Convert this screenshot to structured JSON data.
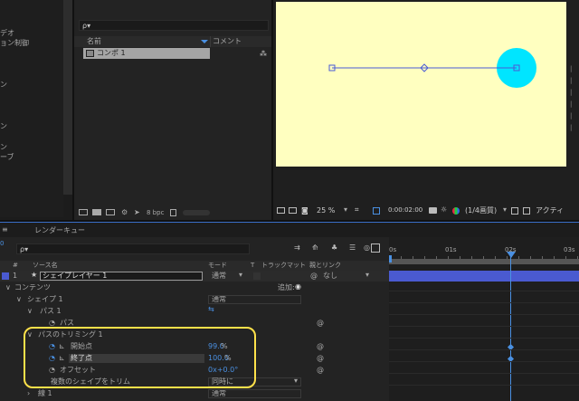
{
  "left_panel": {
    "items": [
      "デオ",
      "ョン制御",
      "ン",
      "ン",
      "ン",
      "ーブ"
    ]
  },
  "project": {
    "search_placeholder": "ρ▾",
    "col_name": "名前",
    "col_comment": "コメント",
    "item_name": "コンポ 1",
    "bpc_label": "8 bpc"
  },
  "viewer": {
    "zoom": "25 %",
    "timecode": "0:00:02:00",
    "resolution": "(1/4画質)",
    "active_label": "アクティ",
    "canvas_bg": "#ffffc0",
    "circle_color": "#00e5ff",
    "path_color": "#4a5bd6"
  },
  "timeline": {
    "render_queue_tab": "レンダーキュー",
    "search_placeholder": "ρ▾",
    "col_hash": "#",
    "col_source": "ソース名",
    "col_mode": "モード",
    "col_t": "T",
    "col_trackmatte": "トラックマット",
    "col_parent": "親とリンク",
    "ruler_labels": [
      "0s",
      "01s",
      "02s",
      "03s"
    ],
    "layer_number": "1",
    "layer_name": "シェイプレイヤー 1",
    "layer_mode": "通常",
    "layer_parent": "なし",
    "contents_label": "コンテンツ",
    "add_label": "追加:",
    "shape_label": "シェイプ 1",
    "shape_mode": "通常",
    "path1_label": "パス 1",
    "path_label": "パス",
    "trim_label": "パスのトリミング 1",
    "start_label": "開始点",
    "start_value": "99.0",
    "end_label": "終了点",
    "end_value": "100.0",
    "offset_label": "オフセット",
    "offset_value": "0x+0.0°",
    "trim_multiple_label": "複数のシェイプをトリム",
    "trim_multiple_value": "同時に",
    "stroke_label": "線 1",
    "stroke_mode": "通常",
    "pct": "%",
    "track_color": "#4a5ad0",
    "highlight_color": "#ffe14a"
  }
}
